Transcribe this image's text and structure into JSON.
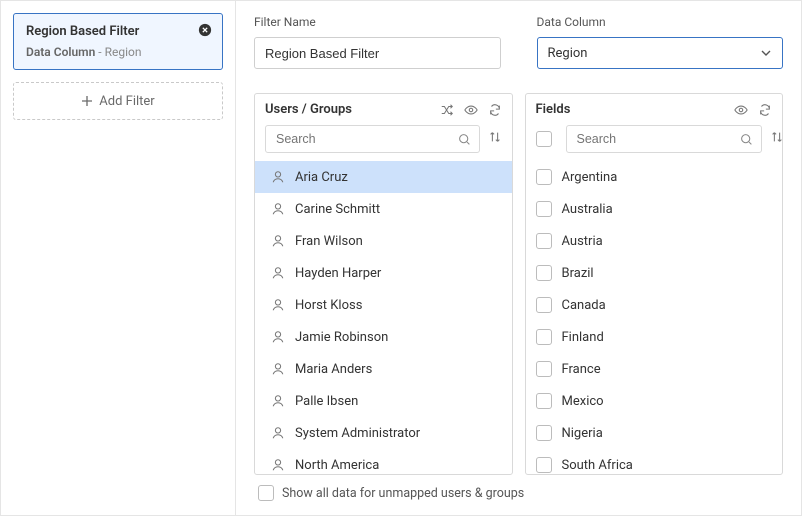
{
  "sidebar": {
    "card": {
      "title": "Region Based Filter",
      "sub_label": "Data Column",
      "sub_value": "Region"
    },
    "add_filter_label": "Add Filter"
  },
  "form": {
    "filter_name_label": "Filter Name",
    "filter_name_value": "Region Based Filter",
    "data_column_label": "Data Column",
    "data_column_value": "Region"
  },
  "users_panel": {
    "title": "Users / Groups",
    "search_placeholder": "Search",
    "items": [
      {
        "name": "Aria Cruz",
        "active": true
      },
      {
        "name": "Carine Schmitt"
      },
      {
        "name": "Fran Wilson"
      },
      {
        "name": "Hayden Harper"
      },
      {
        "name": "Horst Kloss"
      },
      {
        "name": "Jamie Robinson"
      },
      {
        "name": "Maria Anders"
      },
      {
        "name": "Palle Ibsen"
      },
      {
        "name": "System Administrator"
      },
      {
        "name": "North America"
      }
    ]
  },
  "fields_panel": {
    "title": "Fields",
    "search_placeholder": "Search",
    "items": [
      "Argentina",
      "Australia",
      "Austria",
      "Brazil",
      "Canada",
      "Finland",
      "France",
      "Mexico",
      "Nigeria",
      "South Africa"
    ]
  },
  "footer": {
    "show_all_label": "Show all data for unmapped users & groups"
  }
}
